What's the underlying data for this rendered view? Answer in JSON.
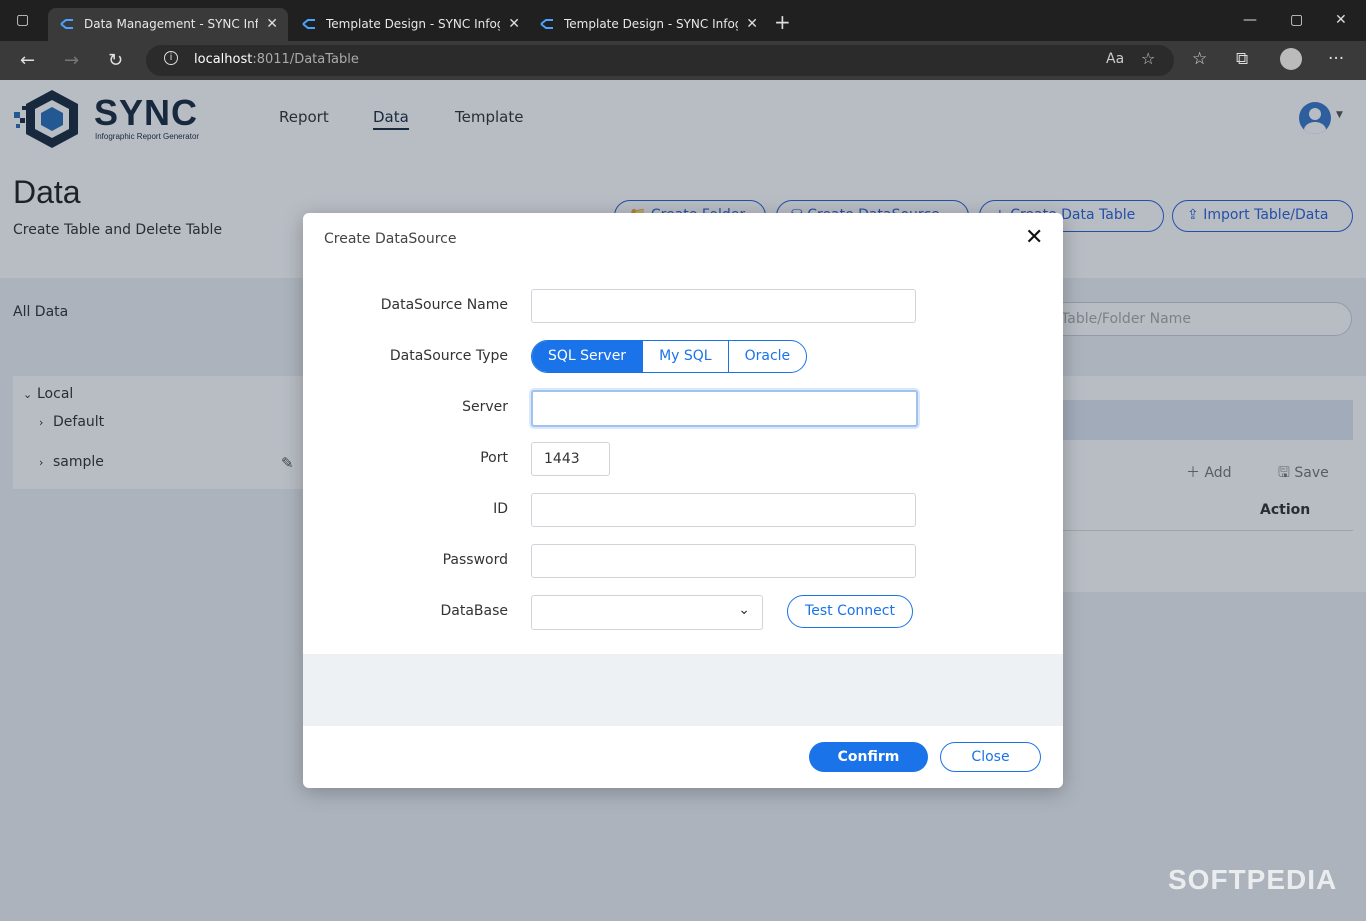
{
  "browser": {
    "tabs": [
      {
        "title": "Data Management - SYNC Infographic Report Generator",
        "active": true
      },
      {
        "title": "Template Design - SYNC Infographic Report Generator",
        "active": false
      },
      {
        "title": "Template Design - SYNC Infographic Report Generator",
        "active": false
      }
    ],
    "url_host": "localhost",
    "url_path": ":8011/DataTable"
  },
  "app": {
    "logo_text": "SYNC",
    "logo_subtitle": "Infographic Report Generator",
    "nav": [
      "Report",
      "Data",
      "Template"
    ],
    "active_nav": "Data"
  },
  "page": {
    "title": "Data",
    "subtitle": "Create Table and Delete Table",
    "buttons": {
      "create_folder": "Create Folder",
      "create_datasource": "Create DataSource",
      "create_data_table": "Create Data Table",
      "import": "Import Table/Data"
    },
    "all_data_label": "All Data",
    "search_placeholder": "Table/Folder Name",
    "tree": {
      "root": "Local",
      "children": [
        "Default",
        "sample"
      ]
    },
    "grid": {
      "add": "Add",
      "save": "Save",
      "action_header": "Action"
    }
  },
  "modal": {
    "title": "Create DataSource",
    "fields": {
      "name_label": "DataSource Name",
      "type_label": "DataSource Type",
      "server_label": "Server",
      "port_label": "Port",
      "port_value": "1443",
      "id_label": "ID",
      "password_label": "Password",
      "database_label": "DataBase"
    },
    "types": [
      "SQL Server",
      "My SQL",
      "Oracle"
    ],
    "selected_type": "SQL Server",
    "test_connect": "Test Connect",
    "confirm": "Confirm",
    "close": "Close"
  },
  "watermark": "SOFTPEDIA",
  "colors": {
    "accent": "#1a73e8",
    "brand_dark": "#1b2b40",
    "chrome_dark": "#202020"
  }
}
